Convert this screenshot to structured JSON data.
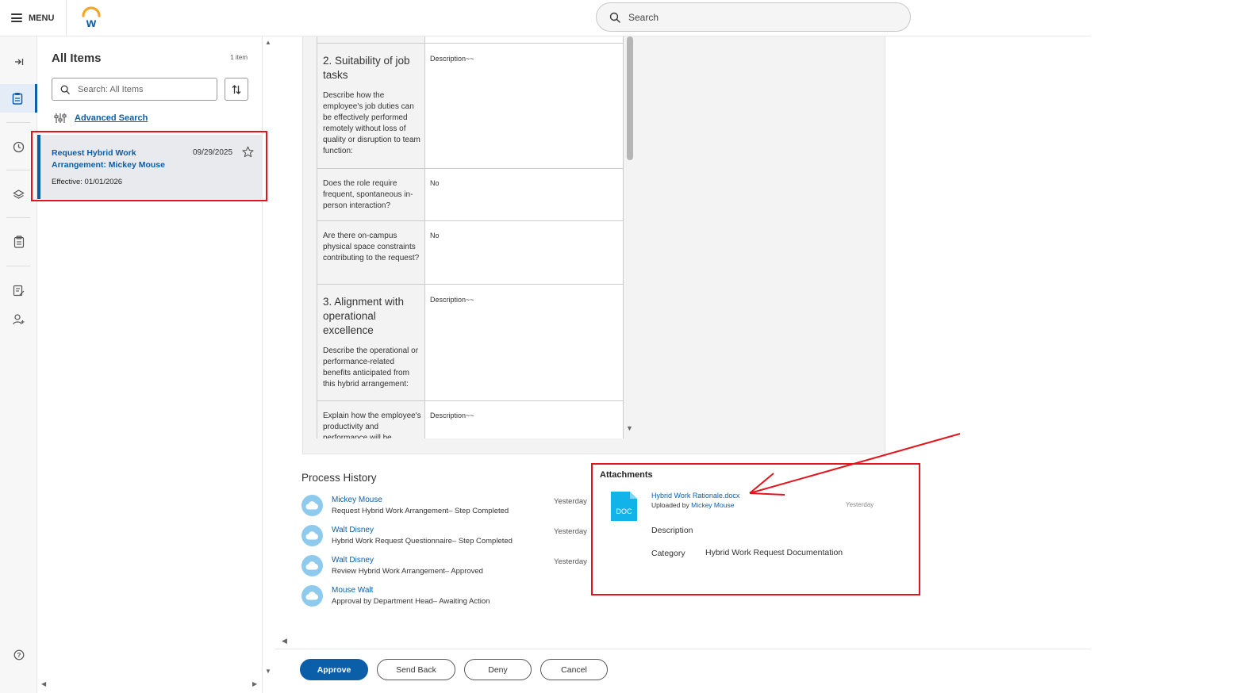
{
  "topbar": {
    "menu_label": "MENU",
    "search_placeholder": "Search"
  },
  "list": {
    "title": "All Items",
    "count": "1 item",
    "search_placeholder": "Search: All Items",
    "advanced_search": "Advanced Search",
    "item": {
      "title": "Request Hybrid Work Arrangement: Mickey Mouse",
      "date": "09/29/2025",
      "effective": "Effective: 01/01/2026"
    }
  },
  "form": {
    "rows": [
      {
        "title": "",
        "desc": "",
        "value": ""
      },
      {
        "title": "2. Suitability of job tasks",
        "desc": "Describe how the employee's job duties can be effectively performed remotely without loss of quality or disruption to team function:",
        "value": "Description~~"
      },
      {
        "title": "",
        "desc": "Does the role require frequent, spontaneous in-person interaction?",
        "value": "No"
      },
      {
        "title": "",
        "desc": "Are there on-campus physical space constraints contributing to the request?",
        "value": "No"
      },
      {
        "title": "3. Alignment with operational excellence",
        "desc": "Describe the operational or performance-related benefits anticipated from this hybrid arrangement:",
        "value": "Description~~"
      },
      {
        "title": "",
        "desc": "Explain how the employee's productivity and performance will be",
        "value": "Description~~"
      }
    ]
  },
  "process_history": {
    "title": "Process History",
    "items": [
      {
        "name": "Mickey Mouse",
        "desc": "Request Hybrid Work Arrangement– Step Completed",
        "time": "Yesterday"
      },
      {
        "name": "Walt Disney",
        "desc": "Hybrid Work Request Questionnaire– Step Completed",
        "time": "Yesterday"
      },
      {
        "name": "Walt Disney",
        "desc": "Review Hybrid Work Arrangement– Approved",
        "time": "Yesterday"
      },
      {
        "name": "Mouse  Walt",
        "desc": "Approval by Department Head– Awaiting Action",
        "time": ""
      }
    ]
  },
  "attachments": {
    "title": "Attachments",
    "file_name": "Hybrid Work Rationale.docx",
    "uploaded_by_prefix": "Uploaded by",
    "uploaded_by": "Mickey Mouse",
    "time": "Yesterday",
    "doc_label": "DOC",
    "description_label": "Description",
    "category_label": "Category",
    "category_value": "Hybrid Work Request Documentation"
  },
  "actions": {
    "approve": "Approve",
    "send_back": "Send Back",
    "deny": "Deny",
    "cancel": "Cancel"
  },
  "colors": {
    "accent": "#0b5ea8",
    "annotation_red": "#e4141c",
    "avatar": "#8ec9ee",
    "doc_icon": "#12b3e8"
  }
}
